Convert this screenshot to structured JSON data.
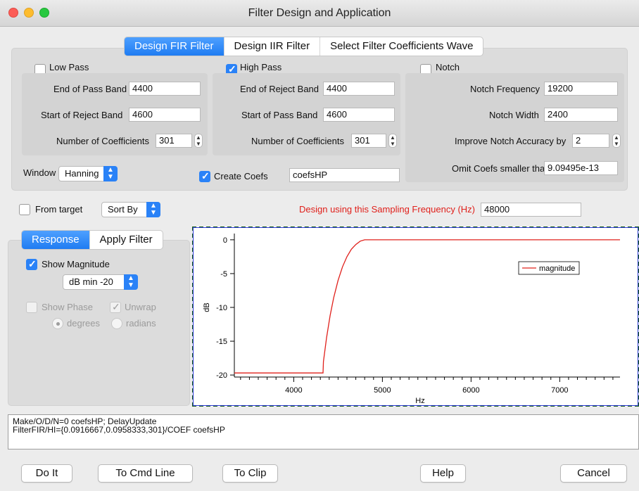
{
  "window": {
    "title": "Filter Design and Application"
  },
  "design_tabs": [
    {
      "label": "Design FIR Filter",
      "active": true
    },
    {
      "label": "Design IIR Filter",
      "active": false
    },
    {
      "label": "Select Filter Coefficients Wave",
      "active": false
    }
  ],
  "low_pass": {
    "label": "Low Pass",
    "checked": false,
    "end_pass_label": "End of Pass Band",
    "end_pass_value": "4400",
    "start_reject_label": "Start of Reject Band",
    "start_reject_value": "4600",
    "coefs_label": "Number of Coefficients",
    "coefs_value": "301"
  },
  "high_pass": {
    "label": "High Pass",
    "checked": true,
    "end_reject_label": "End of Reject Band",
    "end_reject_value": "4400",
    "start_pass_label": "Start of Pass Band",
    "start_pass_value": "4600",
    "coefs_label": "Number of Coefficients",
    "coefs_value": "301"
  },
  "notch": {
    "label": "Notch",
    "checked": false,
    "freq_label": "Notch Frequency",
    "freq_value": "19200",
    "width_label": "Notch Width",
    "width_value": "2400",
    "accuracy_label": "Improve Notch Accuracy by",
    "accuracy_value": "2",
    "omit_label": "Omit Coefs smaller than",
    "omit_value": "9.09495e-13"
  },
  "window_select": {
    "label": "Window",
    "value": "Hanning"
  },
  "create_coefs": {
    "label": "Create Coefs",
    "checked": true,
    "name_value": "coefsHP"
  },
  "from_target": {
    "label": "From target",
    "checked": false
  },
  "sort_by": {
    "value": "Sort By"
  },
  "sampling": {
    "label": "Design using this Sampling Frequency (Hz)",
    "value": "48000",
    "label_color": "#e0201b"
  },
  "response_tabs": [
    {
      "label": "Response",
      "active": true
    },
    {
      "label": "Apply Filter",
      "active": false
    }
  ],
  "response": {
    "show_magnitude_label": "Show Magnitude",
    "show_magnitude_checked": true,
    "db_min_value": "dB min -20",
    "show_phase_label": "Show Phase",
    "show_phase_checked": false,
    "unwrap_label": "Unwrap",
    "unwrap_checked": true,
    "degrees_label": "degrees",
    "radians_label": "radians"
  },
  "chart_data": {
    "type": "line",
    "xlabel": "Hz",
    "ylabel": "dB",
    "xlim": [
      3330,
      7680
    ],
    "ylim": [
      -20.3,
      0.3
    ],
    "x_ticks": [
      4000,
      5000,
      6000,
      7000
    ],
    "y_ticks": [
      0,
      -5,
      -10,
      -15,
      -20
    ],
    "legend": {
      "placement": "top-right"
    },
    "series": [
      {
        "name": "magnitude",
        "color": "#e0201b",
        "x": [
          3330,
          4330,
          4335,
          4370,
          4410,
          4450,
          4500,
          4550,
          4600,
          4650,
          4700,
          4750,
          4800,
          4900,
          7680
        ],
        "y": [
          -19.7,
          -19.7,
          -18.0,
          -14.5,
          -11.2,
          -8.6,
          -6.0,
          -4.0,
          -2.5,
          -1.4,
          -0.7,
          -0.2,
          0.0,
          0.0,
          0.0
        ]
      }
    ]
  },
  "command": {
    "line1": "Make/O/D/N=0 coefsHP; DelayUpdate",
    "line2": "FilterFIR/HI={0.0916667,0.0958333,301}/COEF coefsHP"
  },
  "buttons": {
    "do_it": "Do It",
    "to_cmd": "To Cmd Line",
    "to_clip": "To Clip",
    "help": "Help",
    "cancel": "Cancel"
  },
  "colors": {
    "accent": "#2a82f7",
    "close": "#fc5d57",
    "minimize": "#fdbc2e",
    "zoom": "#28c840"
  }
}
